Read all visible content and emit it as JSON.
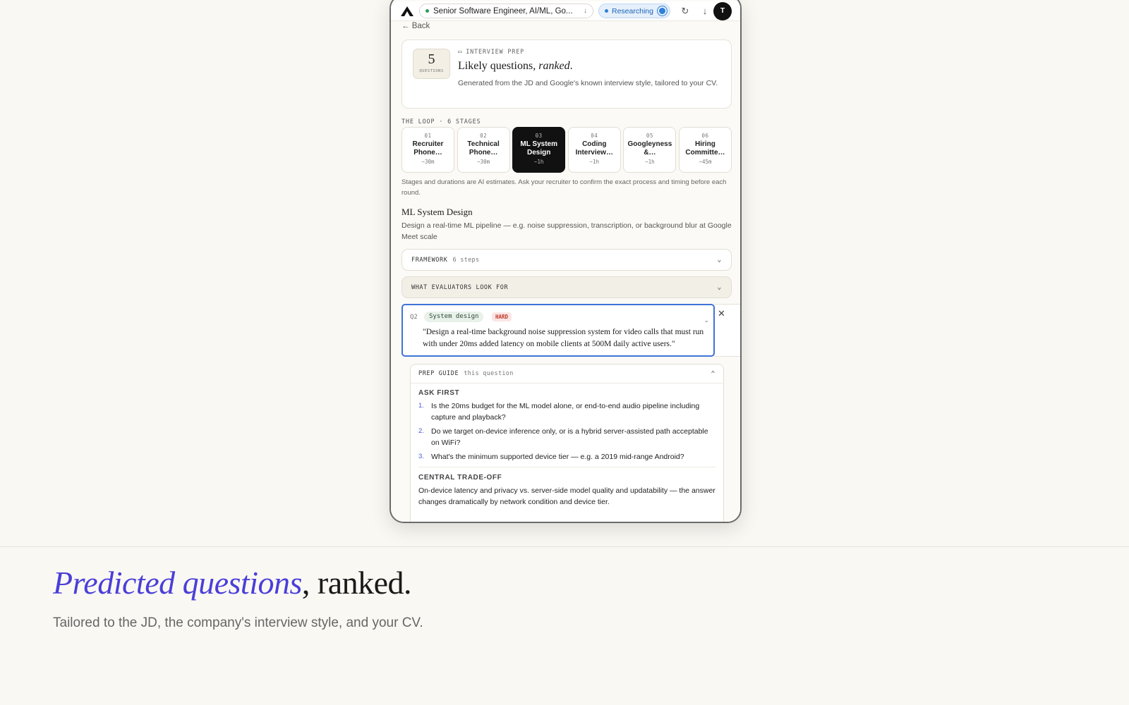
{
  "topbar": {
    "job_title": "Senior Software Engineer, AI/ML, Go...",
    "status": "Researching",
    "avatar_initial": "T"
  },
  "back_label": "← Back",
  "prep": {
    "count": "5",
    "count_label": "QUESTIONS",
    "eyebrow": "INTERVIEW PREP",
    "title_plain": "Likely questions, ",
    "title_italic": "ranked",
    "title_end": ".",
    "description": "Generated from the JD and Google's known interview style, tailored to your CV."
  },
  "loop": {
    "label": "THE LOOP · 6 STAGES",
    "stages": [
      {
        "num": "01",
        "name": "Recruiter Phone…",
        "duration": "~30m"
      },
      {
        "num": "02",
        "name": "Technical Phone…",
        "duration": "~30m"
      },
      {
        "num": "03",
        "name": "ML System Design",
        "duration": "~1h"
      },
      {
        "num": "04",
        "name": "Coding Interview…",
        "duration": "~1h"
      },
      {
        "num": "05",
        "name": "Googleyness &…",
        "duration": "~1h"
      },
      {
        "num": "06",
        "name": "Hiring Committe…",
        "duration": "~45m"
      }
    ],
    "active_index": 2,
    "note": "Stages and durations are AI estimates. Ask your recruiter to confirm the exact process and timing before each round."
  },
  "stage_detail": {
    "title": "ML System Design",
    "description": "Design a real-time ML pipeline — e.g. noise suppression, transcription, or background blur at Google Meet scale"
  },
  "framework": {
    "label": "FRAMEWORK",
    "sub": "6 steps"
  },
  "evaluators": {
    "label": "WHAT EVALUATORS LOOK FOR"
  },
  "question": {
    "num": "Q2",
    "category": "System design",
    "difficulty": "HARD",
    "text": "\"Design a real-time background noise suppression system for video calls that must run with under 20ms added latency on mobile clients at 500M daily active users.\""
  },
  "guide": {
    "label": "PREP GUIDE",
    "sub": "this question",
    "ask_first_label": "ASK FIRST",
    "ask_first": [
      {
        "n": "1.",
        "text": "Is the 20ms budget for the ML model alone, or end-to-end audio pipeline including capture and playback?"
      },
      {
        "n": "2.",
        "text": "Do we target on-device inference only, or is a hybrid server-assisted path acceptable on WiFi?"
      },
      {
        "n": "3.",
        "text": "What's the minimum supported device tier — e.g. a 2019 mid-range Android?"
      }
    ],
    "tradeoff_label": "CENTRAL TRADE-OFF",
    "tradeoff": "On-device latency and privacy vs. server-side model quality and updatability — the answer changes dramatically by network condition and device tier."
  },
  "hero": {
    "accent": "Predicted questions",
    "rest": ", ranked.",
    "subtitle": "Tailored to the JD, the company's interview style, and your CV."
  },
  "colors": {
    "accent": "#4a3fd8",
    "focus": "#3f74d8",
    "hard": "#c0392b"
  }
}
